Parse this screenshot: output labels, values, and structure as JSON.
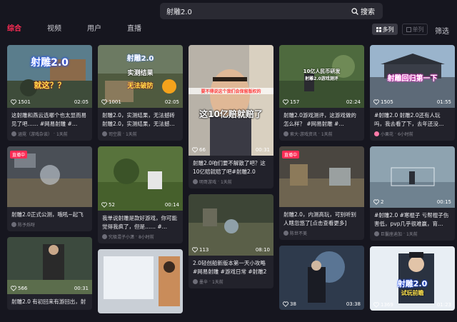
{
  "search": {
    "value": "射雕2.0",
    "button_label": "搜索"
  },
  "tabs": [
    "综合",
    "视频",
    "用户",
    "直播"
  ],
  "view": {
    "multi_label": "多列",
    "single_label": "单列",
    "filter_label": "筛选"
  },
  "colors": {
    "accent": "#fe2c55",
    "background": "#16161f",
    "card": "#22222b"
  },
  "columns": [
    [
      {
        "cover_text": "射雕2.0",
        "cover_text2": "就这？？",
        "likes": "1501",
        "duration": "02:05",
        "title": "这射雕和燕云选哪个也太显而易见了吧…… #网易射雕 #…",
        "author": "涵霓（游戏杂谈）",
        "time": "1天前"
      },
      {
        "live": "直播中",
        "likes": "",
        "duration": "",
        "title": "射雕2.0正式公测，哦吼~起飞",
        "author": "陈予烁呀",
        "time": ""
      },
      {
        "likes": "566",
        "duration": "00:31",
        "title": "射雕2.0 有初回来有游回出，射",
        "author": "",
        "time": ""
      }
    ],
    [
      {
        "cover_text": "射雕2.0",
        "cover_text2": "实测结果",
        "cover_text3": "无法破防",
        "likes": "1001",
        "duration": "02:05",
        "title": "射雕2.0，实测结果，无法撼砖射雕2.0，实测结果，无法撼…",
        "author": "司空震",
        "time": "1天前"
      },
      {
        "likes": "52",
        "duration": "00:14",
        "title": "我单说射雕是款好游戏，你可能觉得我疯了，但是…… #…",
        "author": "究极混子小潇",
        "time": "8小时前"
      },
      {
        "likes": "",
        "duration": "",
        "title": "",
        "author": "",
        "time": ""
      }
    ],
    [
      {
        "cover_text": "这10亿赔就赔了",
        "cover_text2": "要不得说这个我们会保留版权的",
        "likes": "66",
        "duration": "00:31",
        "title": "射雕2.0咱们要不解散了吧？这10亿赔就赔了吧#射雕2.0",
        "author": "明哥游戏",
        "time": "1天前"
      },
      {
        "likes": "113",
        "duration": "08:10",
        "title": "2.0轻创船新版本第一天小攻略#网易射雕 #游戏日常 #射雕2",
        "author": "墨辛",
        "time": "1天前"
      }
    ],
    [
      {
        "cover_text": "10亿人民币研发",
        "cover_text2": "射雕2.0游戏测评",
        "likes": "157",
        "duration": "02:24",
        "title": "射雕2.0游戏测评，这游戏做的怎么样？ #网易射雕 #…",
        "author": "索大·游戏资讯",
        "time": "1天前"
      },
      {
        "live": "直播中",
        "likes": "",
        "duration": "",
        "title": "射雕2.0，内测高玩，可别听别人瞎忽悠了[点击查看更多]",
        "author": "陈世不美",
        "time": ""
      },
      {
        "likes": "38",
        "duration": "03:38",
        "title": "",
        "author": "",
        "time": ""
      }
    ],
    [
      {
        "cover_text": "射雕回归第一下",
        "likes": "1505",
        "duration": "01:55",
        "title": "#射雕2.0 射雕2.0还有人玩吗，我去看了下，去年还没…",
        "author": "小栗花",
        "time": "6小时前"
      },
      {
        "likes": "2",
        "duration": "00:15",
        "title": "#射雕2.0 #寒棍子 亏帮棍子伤害低，pvp几乎很难赢，育…",
        "author": "巨鬣座迪加",
        "time": "1天前"
      },
      {
        "cover_text": "射雕2.0",
        "cover_text2": "试玩前瞻",
        "likes": "1369",
        "duration": "01:23",
        "title": "",
        "author": "",
        "time": ""
      }
    ]
  ]
}
